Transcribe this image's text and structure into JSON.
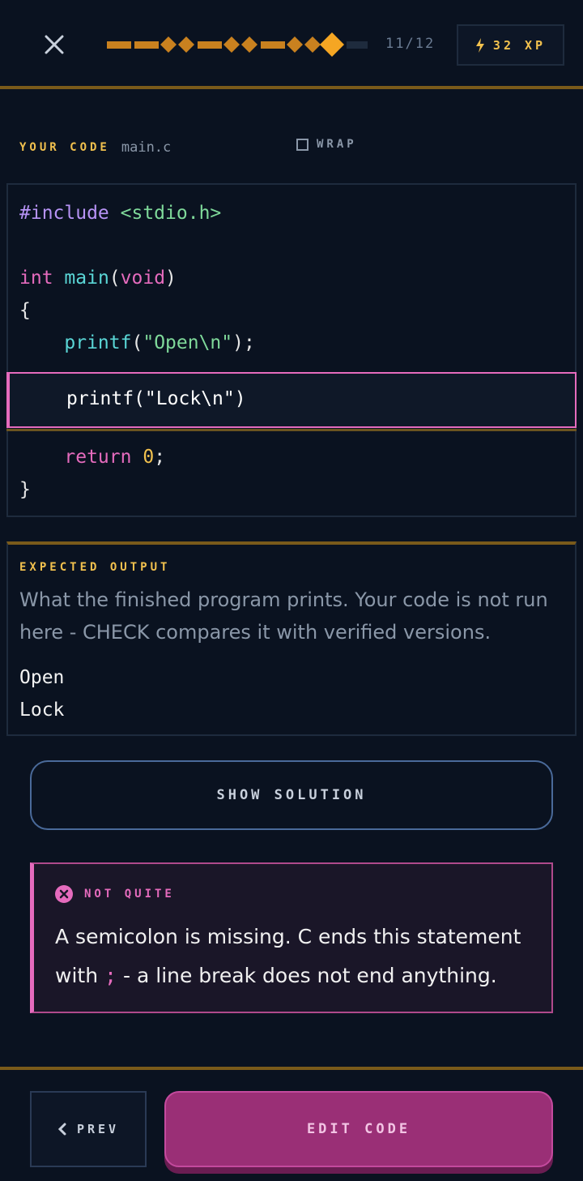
{
  "header": {
    "progress_current": 11,
    "progress_total": 12,
    "progress_count_text": "11/12",
    "xp_text": "32 XP"
  },
  "code_panel": {
    "label": "YOUR CODE",
    "file_name": "main.c",
    "wrap_label": "WRAP",
    "editable_line": "    printf(\"Lock\\n\")"
  },
  "expected": {
    "title": "EXPECTED OUTPUT",
    "description": "What the finished program prints. Your code is not run here - CHECK compares it with verified versions.",
    "output": "Open\nLock"
  },
  "show_solution_label": "SHOW SOLUTION",
  "feedback": {
    "title": "NOT QUITE",
    "text_before": "A semicolon is missing. C ends this statement with ",
    "highlight": ";",
    "text_after": " - a line break does not end anything."
  },
  "footer": {
    "prev_label": "PREV",
    "edit_label": "EDIT CODE"
  },
  "colors": {
    "accent_gold": "#f2c14e",
    "accent_pink": "#e56bbd",
    "background": "#0a1220"
  },
  "icons": {
    "close": "close-icon",
    "xp": "lightning-icon",
    "error": "error-icon",
    "prev": "chevron-left-icon"
  }
}
